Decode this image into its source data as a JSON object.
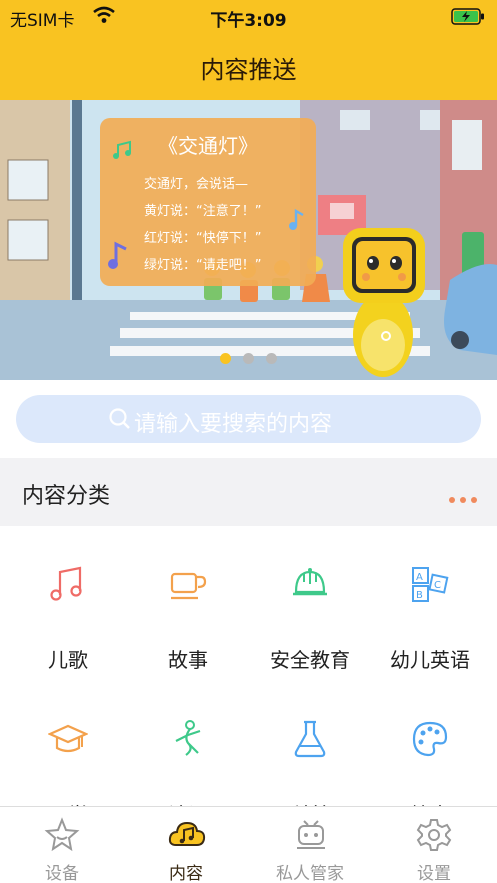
{
  "status_bar": {
    "carrier": "无SIM卡",
    "time": "下午3:09"
  },
  "nav": {
    "title": "内容推送"
  },
  "banner": {
    "poem_title": "《交通灯》",
    "poem_lines": [
      "交通灯，会说话—",
      "黄灯说：“注意了！”",
      "红灯说：“快停下！”",
      "绿灯说：“请走吧！”"
    ],
    "slide_count": 3,
    "active_slide": 1
  },
  "search": {
    "placeholder": "请输入要搜索的内容"
  },
  "category": {
    "title": "内容分类"
  },
  "categories": [
    {
      "label": "儿歌",
      "icon": "music-note-icon",
      "color": "#ef6b66"
    },
    {
      "label": "故事",
      "icon": "coffee-cup-icon",
      "color": "#f3a14c"
    },
    {
      "label": "安全教育",
      "icon": "helmet-icon",
      "color": "#3ec98a"
    },
    {
      "label": "幼儿英语",
      "icon": "abc-blocks-icon",
      "color": "#4da3ef"
    },
    {
      "label": "国学",
      "icon": "graduation-cap-icon",
      "color": "#f3a14c"
    },
    {
      "label": "诗词",
      "icon": "dancer-icon",
      "color": "#3ec98a"
    },
    {
      "label": "科普",
      "icon": "flask-icon",
      "color": "#4da3ef"
    },
    {
      "label": "绘本",
      "icon": "palette-icon",
      "color": "#4da3ef"
    }
  ],
  "tabs": [
    {
      "label": "设备",
      "icon": "star-icon"
    },
    {
      "label": "内容",
      "icon": "music-cloud-icon",
      "active": true
    },
    {
      "label": "私人管家",
      "icon": "robot-icon"
    },
    {
      "label": "设置",
      "icon": "gear-icon"
    }
  ]
}
